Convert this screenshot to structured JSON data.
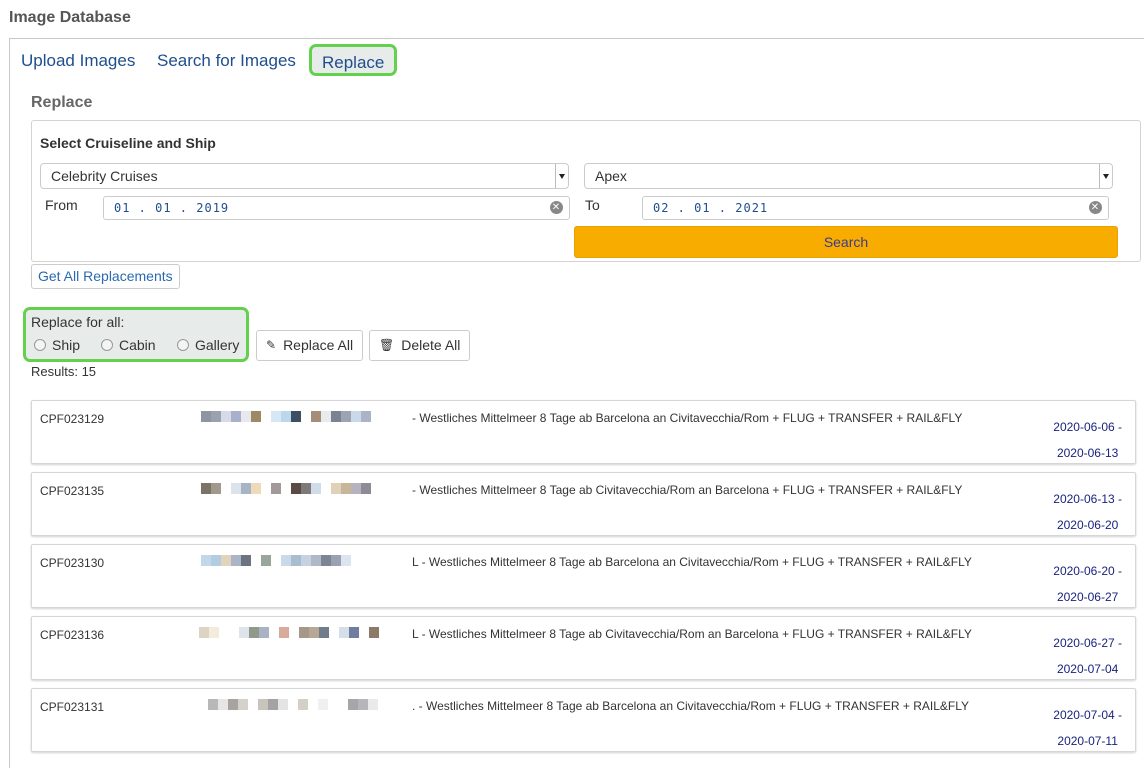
{
  "app": {
    "title": "Image Database"
  },
  "tabs": [
    {
      "label": "Upload Images"
    },
    {
      "label": "Search for Images"
    },
    {
      "label": "Replace",
      "active": true
    }
  ],
  "replace": {
    "title": "Replace",
    "select_title": "Select Cruiseline and Ship",
    "cruiseline": "Celebrity Cruises",
    "ship": "Apex",
    "from_label": "From",
    "from_value": "01.01.2019",
    "to_label": "To",
    "to_value": "02.01.2021",
    "search_label": "Search",
    "get_all_label": "Get All Replacements"
  },
  "replace_all": {
    "title": "Replace for all:",
    "options": [
      "Ship",
      "Cabin",
      "Gallery"
    ],
    "replace_all_label": "Replace All",
    "delete_all_label": "Delete All"
  },
  "results": {
    "count_text": "Results: 15",
    "items": [
      {
        "code": "CPF023129",
        "desc": "- Westliches Mittelmeer 8 Tage ab Barcelona an Civitavecchia/Rom + FLUG + TRANSFER + RAIL&FLY",
        "date_from": "2020-06-06 -",
        "date_to": "2020-06-13"
      },
      {
        "code": "CPF023135",
        "desc": "- Westliches Mittelmeer 8 Tage ab Civitavecchia/Rom an Barcelona + FLUG + TRANSFER + RAIL&FLY",
        "date_from": "2020-06-13 -",
        "date_to": "2020-06-20"
      },
      {
        "code": "CPF023130",
        "desc": "L - Westliches Mittelmeer 8 Tage ab Barcelona an Civitavecchia/Rom + FLUG + TRANSFER + RAIL&FLY",
        "date_from": "2020-06-20 -",
        "date_to": "2020-06-27"
      },
      {
        "code": "CPF023136",
        "desc": "L - Westliches Mittelmeer 8 Tage ab Civitavecchia/Rom an Barcelona + FLUG + TRANSFER + RAIL&FLY",
        "date_from": "2020-06-27 -",
        "date_to": "2020-07-04"
      },
      {
        "code": "CPF023131",
        "desc": ". - Westliches Mittelmeer 8 Tage ab Barcelona an Civitavecchia/Rom + FLUG + TRANSFER + RAIL&FLY",
        "date_from": "2020-07-04 -",
        "date_to": "2020-07-11"
      }
    ]
  },
  "colors": {
    "accent_orange": "#f8ac00",
    "highlight_green": "#63d14d",
    "link_blue": "#1f4e8c",
    "date_navy": "#1a237e"
  }
}
